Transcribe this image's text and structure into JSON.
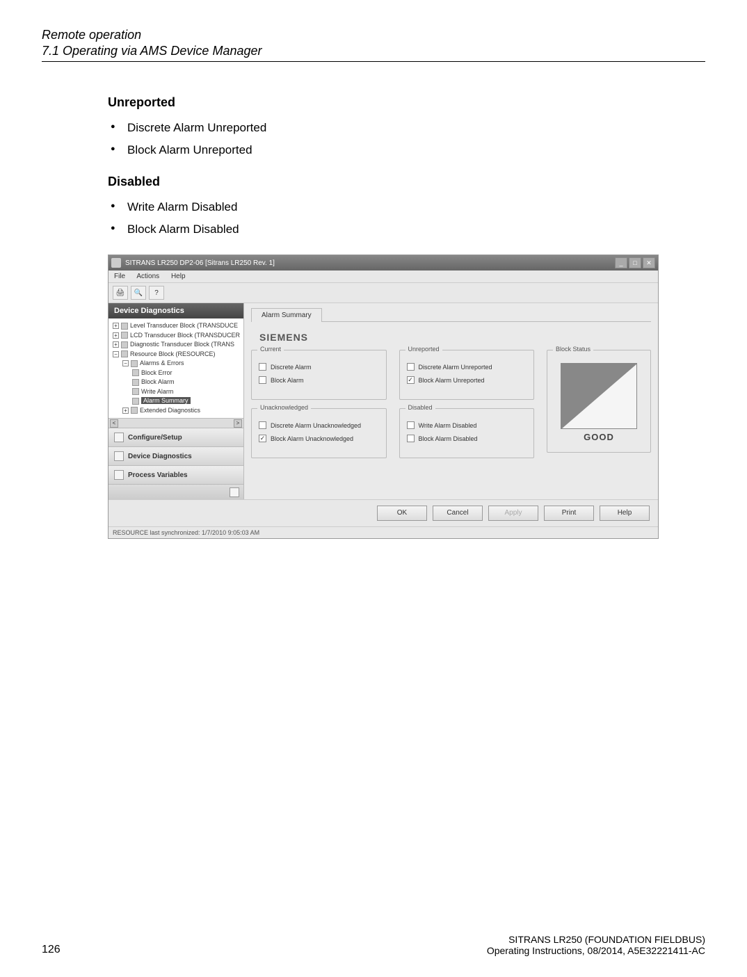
{
  "header": {
    "title": "Remote operation",
    "subtitle": "7.1 Operating via AMS Device Manager"
  },
  "sections": {
    "unreported": {
      "heading": "Unreported",
      "items": [
        "Discrete Alarm Unreported",
        "Block Alarm Unreported"
      ]
    },
    "disabled": {
      "heading": "Disabled",
      "items": [
        "Write Alarm Disabled",
        "Block Alarm Disabled"
      ]
    }
  },
  "screenshot": {
    "window_title": "SITRANS LR250   DP2-06 [Sitrans LR250 Rev. 1]",
    "menu": {
      "file": "File",
      "actions": "Actions",
      "help": "Help"
    },
    "toolbar": {
      "b1": "🖨",
      "b2": "🔍",
      "b3": "?"
    },
    "nav_header": "Device Diagnostics",
    "tree": {
      "item0": "Level Transducer Block (TRANSDUCE",
      "item1": "LCD Transducer Block (TRANSDUCER",
      "item2": "Diagnostic Transducer Block (TRANS",
      "item3": "Resource Block (RESOURCE)",
      "item3a": "Alarms & Errors",
      "item3a1": "Block Error",
      "item3a2": "Block Alarm",
      "item3a3": "Write Alarm",
      "item3a4": "Alarm Summary",
      "item3b": "Extended Diagnostics"
    },
    "nav_buttons": {
      "configure": "Configure/Setup",
      "diagnostics": "Device Diagnostics",
      "process": "Process Variables"
    },
    "tab": "Alarm Summary",
    "brand": "SIEMENS",
    "groups": {
      "current": {
        "title": "Current",
        "discrete": "Discrete Alarm",
        "block": "Block Alarm"
      },
      "unacknowledged": {
        "title": "Unacknowledged",
        "discrete": "Discrete Alarm Unacknowledged",
        "block": "Block Alarm Unacknowledged"
      },
      "unreported": {
        "title": "Unreported",
        "discrete": "Discrete Alarm Unreported",
        "block": "Block Alarm Unreported"
      },
      "disabled": {
        "title": "Disabled",
        "write": "Write Alarm Disabled",
        "block": "Block Alarm Disabled"
      },
      "block_status": {
        "title": "Block Status",
        "label": "GOOD"
      }
    },
    "buttons": {
      "ok": "OK",
      "cancel": "Cancel",
      "apply": "Apply",
      "print": "Print",
      "help": "Help"
    },
    "status_bar": "RESOURCE last synchronized: 1/7/2010 9:05:03 AM"
  },
  "footer": {
    "product": "SITRANS LR250 (FOUNDATION FIELDBUS)",
    "docinfo": "Operating Instructions, 08/2014, A5E32221411-AC",
    "page": "126"
  }
}
